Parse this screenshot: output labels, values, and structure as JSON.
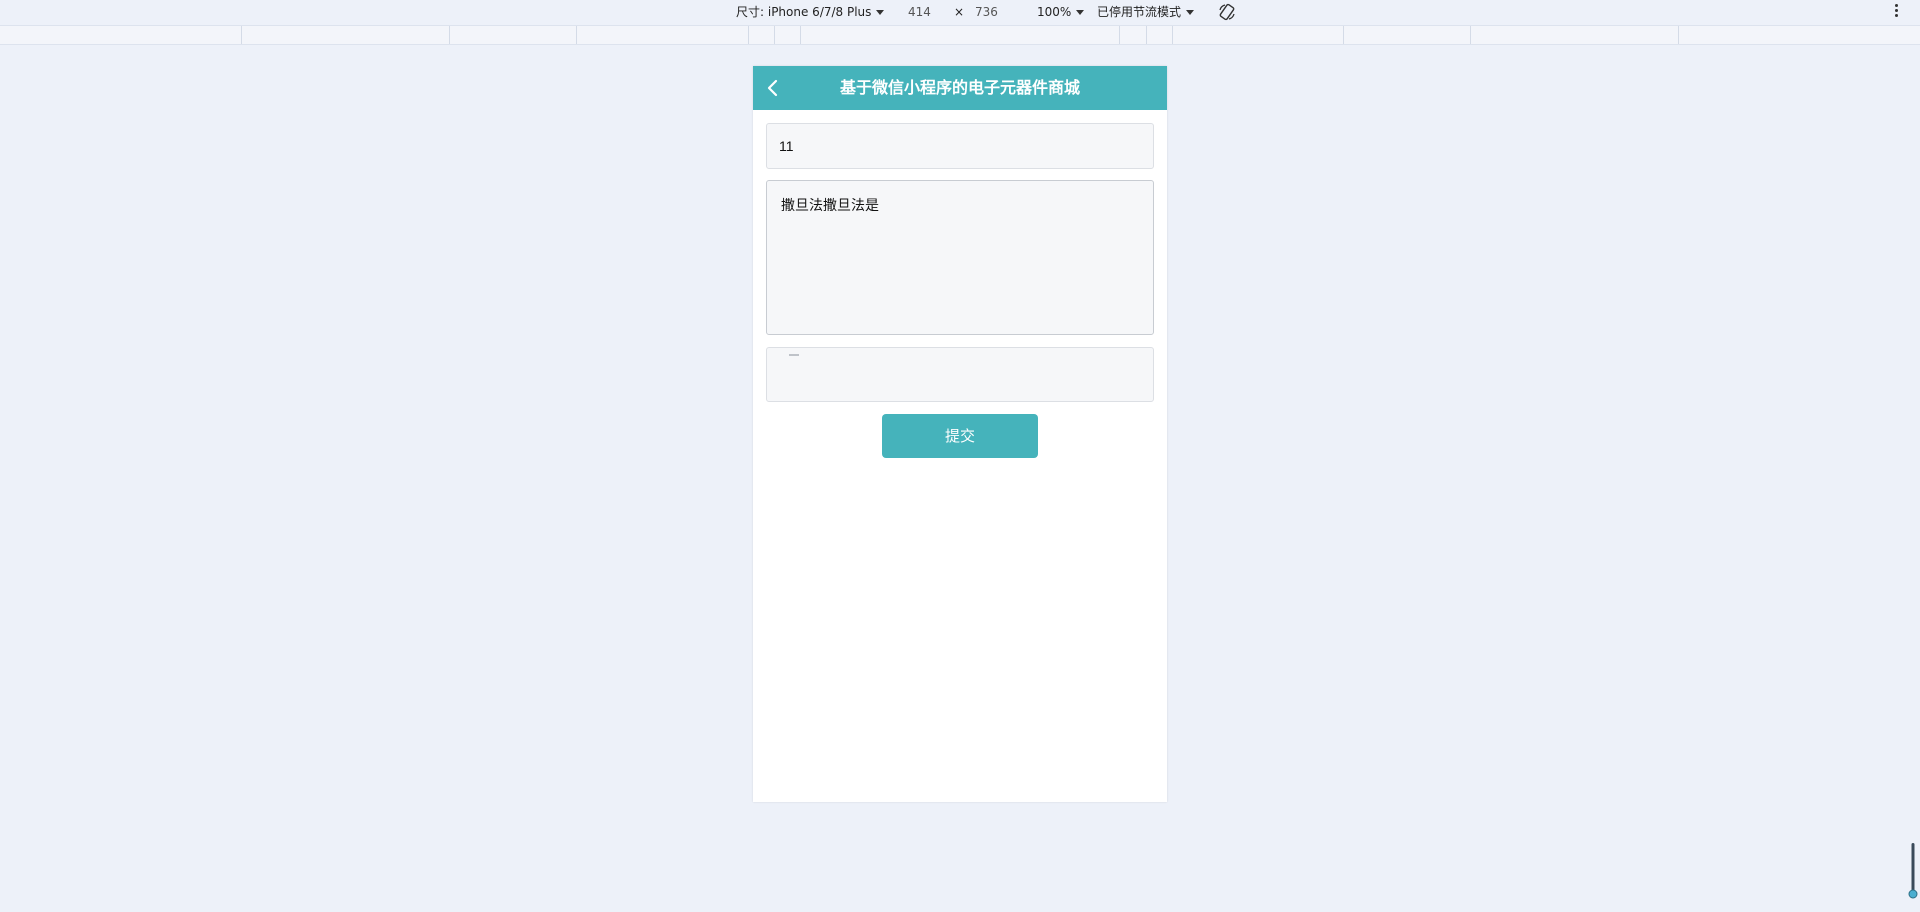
{
  "devtools": {
    "device_label": "尺寸: iPhone 6/7/8 Plus",
    "width": "414",
    "times": "×",
    "height": "736",
    "zoom": "100%",
    "throttle": "已停用节流模式",
    "rotate_icon": "rotate-icon",
    "more_icon": "vertical-dots-icon"
  },
  "page": {
    "title": "基于微信小程序的电子元器件商城",
    "back_icon": "chevron-left-icon",
    "accent_color": "#45b3bb"
  },
  "form": {
    "title_value": "11",
    "content_value": "撒旦法撒旦法是",
    "submit_label": "提交"
  }
}
